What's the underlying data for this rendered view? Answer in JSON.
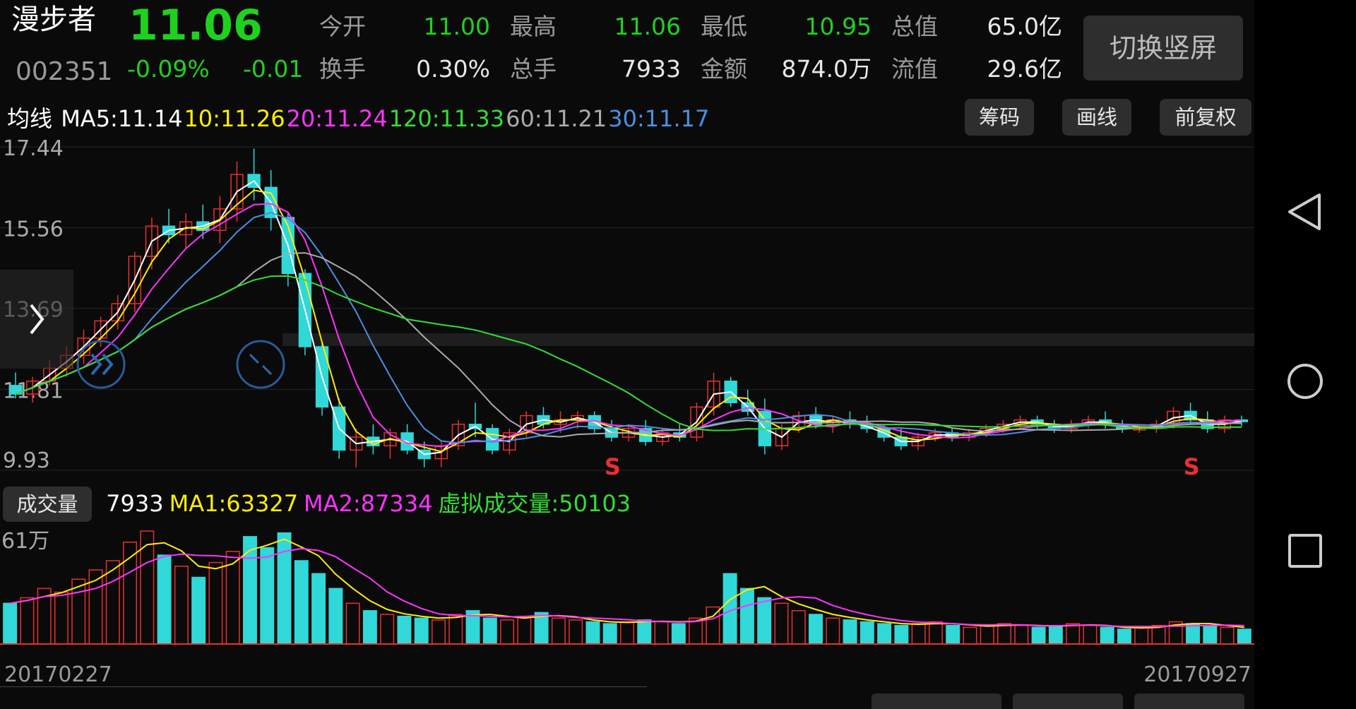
{
  "header": {
    "stock_name": "漫步者",
    "price": "11.06",
    "code": "002351",
    "change_pct": "-0.09%",
    "change": "-0.01",
    "fields": [
      {
        "label": "今开",
        "value": "11.00",
        "value_color": "#1fd11f"
      },
      {
        "label": "最高",
        "value": "11.06",
        "value_color": "#1fd11f"
      },
      {
        "label": "最低",
        "value": "10.95",
        "value_color": "#1fd11f"
      },
      {
        "label": "总值",
        "value": "65.0亿",
        "value_color": "#e8e8e8"
      },
      {
        "label": "换手",
        "value": "0.30%",
        "value_color": "#e8e8e8"
      },
      {
        "label": "总手",
        "value": "7933",
        "value_color": "#e8e8e8"
      },
      {
        "label": "金额",
        "value": "874.0万",
        "value_color": "#e8e8e8"
      },
      {
        "label": "流值",
        "value": "29.6亿",
        "value_color": "#e8e8e8"
      }
    ],
    "switch_button": "切换竖屏"
  },
  "ma_bar": {
    "prefix": "均线",
    "items": [
      {
        "text": "MA5:11.14",
        "color": "#ffffff"
      },
      {
        "text": "10:11.26",
        "color": "#ffee00"
      },
      {
        "text": "20:11.24",
        "color": "#ff33ff"
      },
      {
        "text": "120:11.33",
        "color": "#33dd33"
      },
      {
        "text": "60:11.21",
        "color": "#aaaaaa"
      },
      {
        "text": "30:11.17",
        "color": "#4a90e2"
      }
    ],
    "buttons": [
      "筹码",
      "画线",
      "前复权"
    ]
  },
  "volume_bar": {
    "tab_label": "成交量",
    "items": [
      {
        "text": "7933",
        "color": "#ffffff"
      },
      {
        "text": "MA1:63327",
        "color": "#ffee00"
      },
      {
        "text": "MA2:87334",
        "color": "#ff33ff"
      },
      {
        "text": "虚拟成交量:50103",
        "color": "#33dd33"
      }
    ]
  },
  "dates": {
    "start": "20170227",
    "end": "20170927"
  },
  "icons": {
    "expand": "chevron-right-icon",
    "fast_forward": "double-chevron-icon",
    "collapse": "shrink-arrows-icon",
    "nav_back": "back-triangle-icon",
    "nav_home": "home-circle-icon",
    "nav_recent": "recent-square-icon"
  },
  "colors": {
    "up": "#e83030",
    "down": "#30d8d8"
  },
  "chart_data": [
    {
      "type": "candlestick",
      "y_tick_labels": [
        "17.44",
        "15.56",
        "13.69",
        "11.81",
        "9.93"
      ],
      "y_ticks": [
        17.44,
        15.56,
        13.69,
        11.81,
        9.93
      ],
      "ylim": [
        9.93,
        17.44
      ],
      "markers": [
        {
          "text": "S",
          "index": 122,
          "color": "#e83030"
        },
        {
          "text": "S",
          "index": 240,
          "color": "#e83030"
        }
      ],
      "ohlc_sampled": [
        [
          11.9,
          12.2,
          11.6,
          11.7
        ],
        [
          11.7,
          12.1,
          11.5,
          12.0
        ],
        [
          12.0,
          12.5,
          11.9,
          12.3
        ],
        [
          12.3,
          12.8,
          12.1,
          12.6
        ],
        [
          12.6,
          13.2,
          12.4,
          13.0
        ],
        [
          13.0,
          13.5,
          12.8,
          13.4
        ],
        [
          13.4,
          14.0,
          13.2,
          13.8
        ],
        [
          13.8,
          15.0,
          13.6,
          14.9
        ],
        [
          14.9,
          15.8,
          14.6,
          15.6
        ],
        [
          15.6,
          16.0,
          15.2,
          15.4
        ],
        [
          15.4,
          15.9,
          15.1,
          15.7
        ],
        [
          15.7,
          16.1,
          15.3,
          15.5
        ],
        [
          15.5,
          16.3,
          15.2,
          16.0
        ],
        [
          16.0,
          17.1,
          15.7,
          16.8
        ],
        [
          16.8,
          17.4,
          16.2,
          16.5
        ],
        [
          16.5,
          16.9,
          15.5,
          15.8
        ],
        [
          15.8,
          15.9,
          14.2,
          14.5
        ],
        [
          14.5,
          14.6,
          12.6,
          12.8
        ],
        [
          12.8,
          12.9,
          11.2,
          11.4
        ],
        [
          11.4,
          11.6,
          10.2,
          10.4
        ],
        [
          10.4,
          10.9,
          10.0,
          10.7
        ],
        [
          10.7,
          11.0,
          10.3,
          10.5
        ],
        [
          10.5,
          10.9,
          10.2,
          10.8
        ],
        [
          10.8,
          11.0,
          10.3,
          10.4
        ],
        [
          10.4,
          10.6,
          10.0,
          10.2
        ],
        [
          10.2,
          10.6,
          10.0,
          10.5
        ],
        [
          10.5,
          11.1,
          10.4,
          11.0
        ],
        [
          11.0,
          11.5,
          10.7,
          10.9
        ],
        [
          10.9,
          11.0,
          10.3,
          10.4
        ],
        [
          10.4,
          10.9,
          10.3,
          10.8
        ],
        [
          10.8,
          11.3,
          10.7,
          11.2
        ],
        [
          11.2,
          11.4,
          10.9,
          11.0
        ],
        [
          11.0,
          11.3,
          10.8,
          11.1
        ],
        [
          11.1,
          11.3,
          10.9,
          11.2
        ],
        [
          11.2,
          11.3,
          10.8,
          10.9
        ],
        [
          10.9,
          11.1,
          10.6,
          10.7
        ],
        [
          10.7,
          11.0,
          10.6,
          10.9
        ],
        [
          10.9,
          11.1,
          10.5,
          10.6
        ],
        [
          10.6,
          10.9,
          10.5,
          10.8
        ],
        [
          10.8,
          11.0,
          10.6,
          10.7
        ],
        [
          10.7,
          11.5,
          10.6,
          11.4
        ],
        [
          11.4,
          12.2,
          11.2,
          12.0
        ],
        [
          12.0,
          12.1,
          11.4,
          11.5
        ],
        [
          11.5,
          11.8,
          11.2,
          11.3
        ],
        [
          11.3,
          11.6,
          10.3,
          10.5
        ],
        [
          10.5,
          11.0,
          10.4,
          10.9
        ],
        [
          10.9,
          11.3,
          10.8,
          11.2
        ],
        [
          11.2,
          11.4,
          10.9,
          11.0
        ],
        [
          11.0,
          11.2,
          10.8,
          11.1
        ],
        [
          11.1,
          11.3,
          10.9,
          11.0
        ],
        [
          11.0,
          11.2,
          10.8,
          10.9
        ],
        [
          10.9,
          11.0,
          10.6,
          10.7
        ],
        [
          10.7,
          10.9,
          10.4,
          10.5
        ],
        [
          10.5,
          10.8,
          10.4,
          10.7
        ],
        [
          10.7,
          10.9,
          10.6,
          10.8
        ],
        [
          10.8,
          10.9,
          10.6,
          10.7
        ],
        [
          10.7,
          10.9,
          10.6,
          10.8
        ],
        [
          10.8,
          11.0,
          10.7,
          10.9
        ],
        [
          10.9,
          11.1,
          10.8,
          11.0
        ],
        [
          11.0,
          11.2,
          10.9,
          11.1
        ],
        [
          11.1,
          11.2,
          10.9,
          11.0
        ],
        [
          11.0,
          11.1,
          10.8,
          10.9
        ],
        [
          10.9,
          11.1,
          10.8,
          11.0
        ],
        [
          11.0,
          11.2,
          10.9,
          11.1
        ],
        [
          11.1,
          11.3,
          10.9,
          11.0
        ],
        [
          11.0,
          11.1,
          10.8,
          10.9
        ],
        [
          10.9,
          11.0,
          10.8,
          10.9
        ],
        [
          10.9,
          11.1,
          10.8,
          11.0
        ],
        [
          11.0,
          11.4,
          10.9,
          11.3
        ],
        [
          11.3,
          11.5,
          11.0,
          11.1
        ],
        [
          11.1,
          11.3,
          10.8,
          10.9
        ],
        [
          10.9,
          11.2,
          10.8,
          11.1
        ],
        [
          11.1,
          11.2,
          10.95,
          11.06
        ]
      ]
    },
    {
      "type": "bar",
      "y_tick_labels": [
        "61万"
      ],
      "x_labels": [
        "20170227",
        "20170927"
      ],
      "volume_sampled": [
        22,
        25,
        30,
        28,
        35,
        40,
        45,
        55,
        61,
        48,
        42,
        36,
        44,
        50,
        58,
        52,
        60,
        45,
        38,
        30,
        22,
        18,
        16,
        15,
        14,
        13,
        16,
        18,
        14,
        13,
        15,
        17,
        14,
        13,
        12,
        11,
        12,
        13,
        12,
        11,
        14,
        20,
        38,
        30,
        25,
        22,
        18,
        16,
        14,
        13,
        12,
        11,
        10,
        11,
        12,
        10,
        9,
        10,
        11,
        10,
        9,
        10,
        11,
        10,
        9,
        8,
        9,
        10,
        12,
        11,
        10,
        9,
        8
      ]
    }
  ]
}
